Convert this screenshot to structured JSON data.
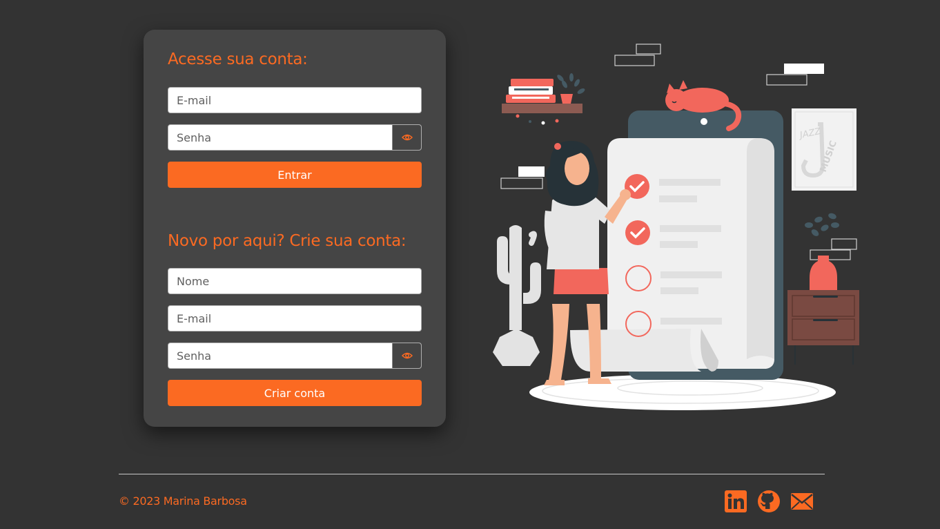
{
  "login": {
    "title": "Acesse sua conta:",
    "email_placeholder": "E-mail",
    "password_placeholder": "Senha",
    "submit_label": "Entrar"
  },
  "signup": {
    "title": "Novo por aqui? Crie sua conta:",
    "name_placeholder": "Nome",
    "email_placeholder": "E-mail",
    "password_placeholder": "Senha",
    "submit_label": "Criar conta"
  },
  "illustration": {
    "poster_text_1": "JAZZ",
    "poster_text_2": "MUSIC"
  },
  "footer": {
    "copyright": "© 2023 Marina Barbosa",
    "social_icons": [
      "linkedin-icon",
      "github-icon",
      "email-icon"
    ]
  },
  "colors": {
    "background": "#333333",
    "card": "#454545",
    "accent": "#fb6a22",
    "input_bg": "#ffffff"
  },
  "icons": {
    "password_toggle": "eye-icon"
  }
}
